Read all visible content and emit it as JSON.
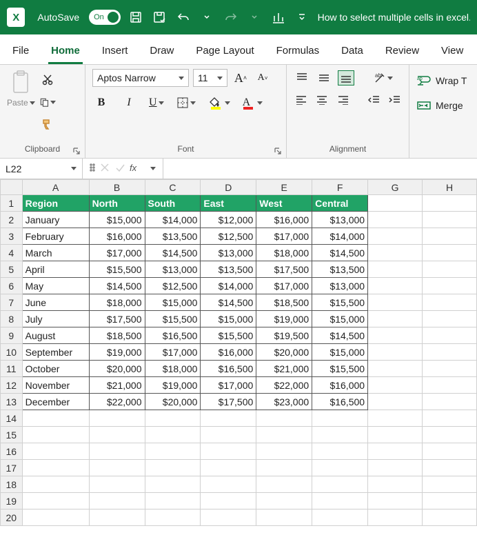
{
  "titlebar": {
    "autosave_label": "AutoSave",
    "autosave_state": "On",
    "doc_title": "How to select multiple cells in excel...."
  },
  "tabs": [
    "File",
    "Home",
    "Insert",
    "Draw",
    "Page Layout",
    "Formulas",
    "Data",
    "Review",
    "View"
  ],
  "active_tab": "Home",
  "ribbon": {
    "clipboard": {
      "label": "Clipboard",
      "paste": "Paste"
    },
    "font": {
      "label": "Font",
      "name": "Aptos Narrow",
      "size": "11",
      "bold": "B",
      "italic": "I",
      "underline": "U"
    },
    "alignment": {
      "label": "Alignment"
    },
    "wrap": {
      "wrap_text": "Wrap T",
      "merge": "Merge "
    }
  },
  "namebox": "L22",
  "columns": [
    "A",
    "B",
    "C",
    "D",
    "E",
    "F",
    "G",
    "H"
  ],
  "headers": [
    "Region",
    "North",
    "South",
    "East",
    "West",
    "Central"
  ],
  "rows": [
    {
      "r": "January",
      "v": [
        "$15,000",
        "$14,000",
        "$12,000",
        "$16,000",
        "$13,000"
      ]
    },
    {
      "r": "February",
      "v": [
        "$16,000",
        "$13,500",
        "$12,500",
        "$17,000",
        "$14,000"
      ]
    },
    {
      "r": "March",
      "v": [
        "$17,000",
        "$14,500",
        "$13,000",
        "$18,000",
        "$14,500"
      ]
    },
    {
      "r": "April",
      "v": [
        "$15,500",
        "$13,000",
        "$13,500",
        "$17,500",
        "$13,500"
      ]
    },
    {
      "r": "May",
      "v": [
        "$14,500",
        "$12,500",
        "$14,000",
        "$17,000",
        "$13,000"
      ]
    },
    {
      "r": "June",
      "v": [
        "$18,000",
        "$15,000",
        "$14,500",
        "$18,500",
        "$15,500"
      ]
    },
    {
      "r": "July",
      "v": [
        "$17,500",
        "$15,500",
        "$15,000",
        "$19,000",
        "$15,000"
      ]
    },
    {
      "r": "August",
      "v": [
        "$18,500",
        "$16,500",
        "$15,500",
        "$19,500",
        "$14,500"
      ]
    },
    {
      "r": "September",
      "v": [
        "$19,000",
        "$17,000",
        "$16,000",
        "$20,000",
        "$15,000"
      ]
    },
    {
      "r": "October",
      "v": [
        "$20,000",
        "$18,000",
        "$16,500",
        "$21,000",
        "$15,500"
      ]
    },
    {
      "r": "November",
      "v": [
        "$21,000",
        "$19,000",
        "$17,000",
        "$22,000",
        "$16,000"
      ]
    },
    {
      "r": "December",
      "v": [
        "$22,000",
        "$20,000",
        "$17,500",
        "$23,000",
        "$16,500"
      ]
    }
  ],
  "empty_rows": [
    14,
    15,
    16,
    17,
    18,
    19,
    20
  ]
}
